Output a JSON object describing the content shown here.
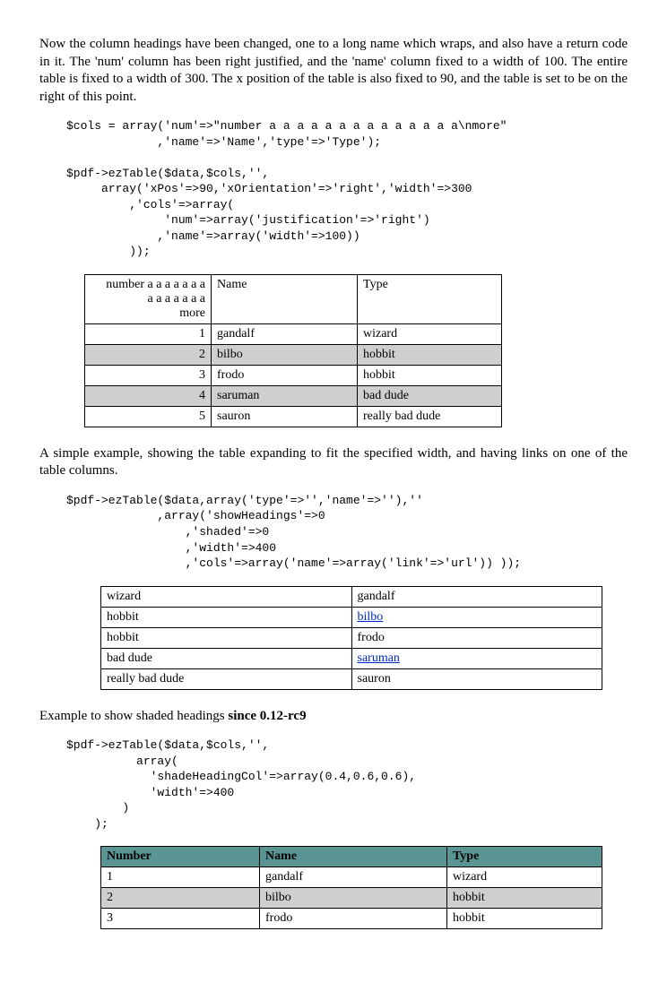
{
  "para1": "Now the column headings have been changed, one to a long name which wraps, and also have a return code in it. The 'num' column has been right justified, and the 'name' column fixed to a width of 100. The entire table is fixed to a width of 300. The x position of the table is also fixed to 90, and the table is set to be on the right of this point.",
  "code1": "$cols = array('num'=>\"number a a a a a a a a a a a a a a\\nmore\"\n             ,'name'=>'Name','type'=>'Type');\n\n$pdf->ezTable($data,$cols,'',\n     array('xPos'=>90,'xOrientation'=>'right','width'=>300\n         ,'cols'=>array(\n              'num'=>array('justification'=>'right')\n             ,'name'=>array('width'=>100))\n         ));",
  "table1": {
    "head": {
      "num": "number a a a a a a a\na a a a a a a\nmore",
      "name": "Name",
      "type": "Type"
    },
    "rows": [
      {
        "num": "1",
        "name": "gandalf",
        "type": "wizard",
        "shaded": false
      },
      {
        "num": "2",
        "name": "bilbo",
        "type": "hobbit",
        "shaded": true
      },
      {
        "num": "3",
        "name": "frodo",
        "type": "hobbit",
        "shaded": false
      },
      {
        "num": "4",
        "name": "saruman",
        "type": "bad dude",
        "shaded": true
      },
      {
        "num": "5",
        "name": "sauron",
        "type": "really bad dude",
        "shaded": false
      }
    ]
  },
  "para2": "A simple example, showing the table expanding to fit the specified width, and having links on one of the table columns.",
  "code2": "$pdf->ezTable($data,array('type'=>'','name'=>''),''\n             ,array('showHeadings'=>0\n                 ,'shaded'=>0\n                 ,'width'=>400\n                 ,'cols'=>array('name'=>array('link'=>'url')) ));",
  "table2": {
    "rows": [
      {
        "type": "wizard",
        "name": "gandalf",
        "link": false
      },
      {
        "type": "hobbit",
        "name": "bilbo",
        "link": true
      },
      {
        "type": "hobbit",
        "name": "frodo",
        "link": false
      },
      {
        "type": "bad dude",
        "name": "saruman",
        "link": true
      },
      {
        "type": "really bad dude",
        "name": "sauron",
        "link": false
      }
    ]
  },
  "para3_a": "Example to show shaded headings ",
  "para3_b": "since 0.12-rc9",
  "code3": "$pdf->ezTable($data,$cols,'',\n          array(\n            'shadeHeadingCol'=>array(0.4,0.6,0.6),\n            'width'=>400\n        )\n    );",
  "table3": {
    "head": {
      "num": "Number",
      "name": "Name",
      "type": "Type"
    },
    "rows": [
      {
        "num": "1",
        "name": "gandalf",
        "type": "wizard",
        "shaded": false
      },
      {
        "num": "2",
        "name": "bilbo",
        "type": "hobbit",
        "shaded": true
      },
      {
        "num": "3",
        "name": "frodo",
        "type": "hobbit",
        "shaded": false
      }
    ]
  }
}
